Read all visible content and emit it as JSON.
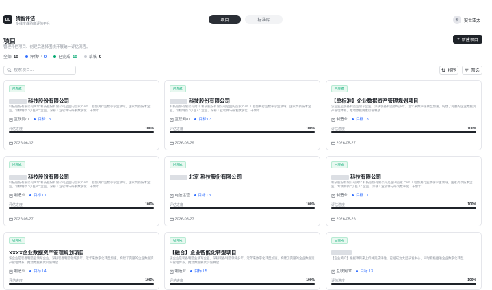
{
  "header": {
    "logo_text": "DC",
    "app_title": "猜智评估",
    "app_subtitle": "多维度成熟度评估平台",
    "tabs": [
      {
        "label": "项目",
        "active": true
      },
      {
        "label": "标准库",
        "active": false
      }
    ],
    "user_avatar": "安",
    "user_name": "安世亚太"
  },
  "page": {
    "title": "项目",
    "description": "管理评估项目、创建后选择围绕开展统一评估流程。",
    "new_button": "新建项目",
    "filters": [
      {
        "label": "全部",
        "count": "10",
        "color": ""
      },
      {
        "label": "评估中",
        "count": "0",
        "color": "#3370ff"
      },
      {
        "label": "已完成",
        "count": "10",
        "color": "#00a870"
      },
      {
        "label": "草稿",
        "count": "0",
        "color": "#c9cdd4"
      }
    ],
    "search_placeholder": "搜索项目...",
    "sort_label": "排序",
    "filter_label": "筛选"
  },
  "cards": [
    {
      "status": "已完成",
      "title": "科技股份有限公司",
      "desc": "科技股份有限公司简介 科技股份有限公司是国内首家 CAE 工程仿真行业数字学生领域，国家高新技术企业，专精特新 \"小巨人\" 企业，深耕工业软件与研发数字化二十余年...",
      "industry": "互联网/IT",
      "target": "目标 L3",
      "progress_label": "评估进度",
      "progress": "100%",
      "date": "2026-06-12"
    },
    {
      "status": "已完成",
      "title": "科技股份有限公司",
      "desc": "科技股份有限公司简介 科技股份有限公司是国内首家 CAE 工程仿真行业数字学生领域，国家高新技术企业，专精特新 \"小巨人\" 企业，深耕工业软件与研发数字化二十余年...",
      "industry": "互联网/IT",
      "target": "目标 L3",
      "progress_label": "评估进度",
      "progress": "100%",
      "date": "2026-05-29"
    },
    {
      "status": "已完成",
      "title": "【单标准】企业数据资产管理规划项目",
      "desc": "该企业是装备制造业领军企业，深耕装备制造领域多年，近年来数字化转型加速，构建了完整的企业数据资产管理体系，推动数据要素价值释放...",
      "industry": "制造业",
      "target": "目标 L3",
      "progress_label": "评估进度",
      "progress": "100%",
      "date": "2026-05-27"
    },
    {
      "status": "已完成",
      "title": "科技股份有限公司",
      "desc": "科技股份有限公司简介 科技股份有限公司是国内首家 CAE 工程仿真行业数字学生领域，国家高新技术企业，专精特新 \"小巨人\" 企业，深耕工业软件与研发数字化二十余年...",
      "industry": "制造业",
      "target": "目标 L1",
      "progress_label": "评估进度",
      "progress": "100%",
      "date": "2026-05-27"
    },
    {
      "status": "已完成",
      "title": "北京 科技股份有限公司",
      "desc": "",
      "industry": "电信运营",
      "target": "目标 L3",
      "progress_label": "评估进度",
      "progress": "100%",
      "date": "2026-05-27"
    },
    {
      "status": "已完成",
      "title": "科技有限公司",
      "desc": "科技股份有限公司简介 科技股份有限公司是国内首家 CAE 工程仿真行业数字学生领域，国家高新技术企业，专精特新 \"小巨人\" 企业，深耕工业软件与研发数字化二十余年...",
      "industry": "制造业",
      "target": "目标 L1",
      "progress_label": "评估进度",
      "progress": "100%",
      "date": "2026-05-26"
    },
    {
      "status": "已完成",
      "title": "XXXX企业数据资产管理规划项目",
      "desc": "该企业是装备制造业领军企业，深耕装备制造领域多年，近年来数字化转型加速，构建了完整的企业数据资产管理体系，推动数据要素价值释放...",
      "industry": "制造业",
      "target": "目标 L4",
      "progress_label": "评估进度",
      "progress": "100%",
      "date": ""
    },
    {
      "status": "已完成",
      "title": "【融合】企业智能化转型项目",
      "desc": "该企业是装备制造业领军企业，深耕装备制造领域多年，近年来数字化转型加速，构建了完整的企业数据资产管理体系，推动数据要素价值释放...",
      "industry": "制造业",
      "target": "目标 L5",
      "progress_label": "评估进度",
      "progress": "100%",
      "date": ""
    },
    {
      "status": "已完成",
      "title": "",
      "desc": "【企业简介】根据项目来上传并完成评估，已经成为大型研发中心，同时积极推进企业数字化转型...",
      "industry": "互联网/IT",
      "target": "目标 L3",
      "progress_label": "评估进度",
      "progress": "100%",
      "date": ""
    }
  ]
}
